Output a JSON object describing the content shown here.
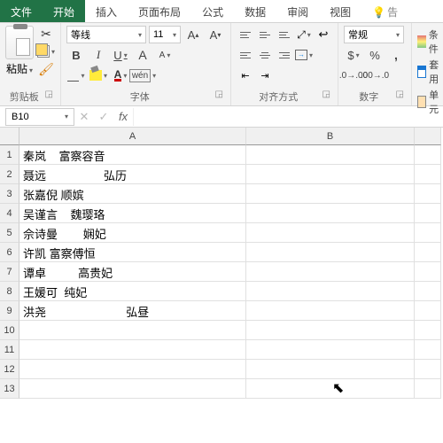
{
  "tabs": {
    "file": "文件",
    "home": "开始",
    "insert": "插入",
    "layout": "页面布局",
    "formulas": "公式",
    "data": "数据",
    "review": "审阅",
    "view": "视图",
    "tell": "告"
  },
  "ribbon": {
    "clipboard": {
      "label": "剪贴板",
      "paste": "粘贴"
    },
    "font": {
      "label": "字体",
      "name": "等线",
      "size": "11",
      "wen": "wén"
    },
    "align": {
      "label": "对齐方式"
    },
    "number": {
      "label": "数字",
      "format": "常规"
    },
    "styles": {
      "cond": "条件",
      "table": "套用",
      "cell": "单元"
    }
  },
  "namebox": "B10",
  "fx_cancel": "✕",
  "fx_ok": "✓",
  "colA": "A",
  "colB": "B",
  "rows": [
    "1",
    "2",
    "3",
    "4",
    "5",
    "6",
    "7",
    "8",
    "9",
    "10",
    "11",
    "12",
    "13"
  ],
  "cells": [
    "秦岚    富察容音",
    "聂远                  弘历",
    "张嘉倪 顺嫔",
    "吴谨言    魏璎珞",
    "佘诗曼        娴妃",
    "许凯 富察傅恒",
    "谭卓          高贵妃",
    "王媛可  纯妃",
    "洪尧                         弘昼",
    "",
    "",
    "",
    ""
  ]
}
